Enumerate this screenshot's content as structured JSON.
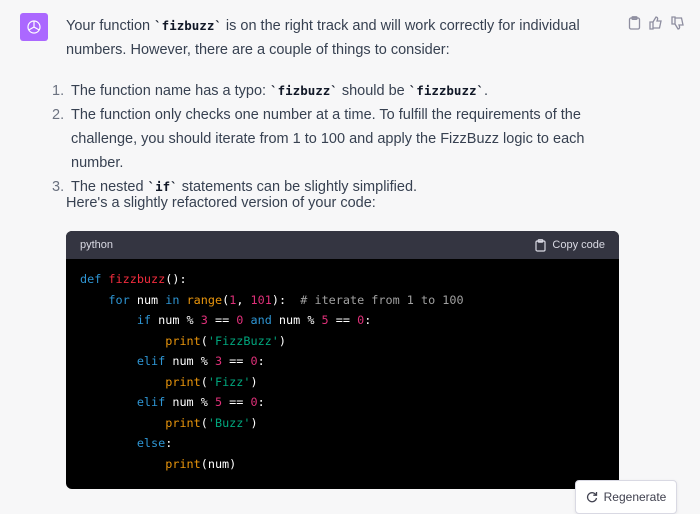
{
  "message": {
    "para1_a": "Your function ",
    "para1_code": "`fizbuzz`",
    "para1_b": " is on the right track and will work correctly for individual numbers. However, there are a couple of things to consider:",
    "list": [
      {
        "num": "1.",
        "a": "The function name has a typo: ",
        "code1": "`fizbuzz`",
        "b": " should be ",
        "code2": "`fizzbuzz`",
        "c": "."
      },
      {
        "num": "2.",
        "text": "The function only checks one number at a time. To fulfill the requirements of the challenge, you should iterate from 1 to 100 and apply the FizzBuzz logic to each number."
      },
      {
        "num": "3.",
        "a": "The nested ",
        "code": "`if`",
        "b": " statements can be slightly simplified."
      }
    ],
    "intro": "Here's a slightly refactored version of your code:"
  },
  "code_block": {
    "language": "python",
    "copy_label": "Copy code",
    "lines": [
      "def fizzbuzz():",
      "    for num in range(1, 101):  # iterate from 1 to 100",
      "        if num % 3 == 0 and num % 5 == 0:",
      "            print('FizzBuzz')",
      "        elif num % 3 == 0:",
      "            print('Fizz')",
      "        elif num % 5 == 0:",
      "            print('Buzz')",
      "        else:",
      "            print(num)"
    ]
  },
  "regenerate_label": "Regenerate",
  "icons": {
    "avatar": "openai-logo-icon",
    "copy_message": "clipboard-icon",
    "thumbs_up": "thumbs-up-icon",
    "thumbs_down": "thumbs-down-icon",
    "copy_code": "clipboard-icon",
    "regenerate": "refresh-icon"
  },
  "colors": {
    "avatar_bg": "#ab68ff",
    "code_bg": "#000000",
    "code_header_bg": "#343541"
  }
}
